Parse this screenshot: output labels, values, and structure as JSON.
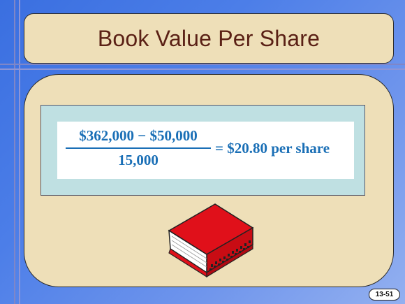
{
  "slide": {
    "title": "Book Value Per Share",
    "formula": {
      "numerator": "$362,000 − $50,000",
      "denominator": "15,000",
      "result": "= $20.80 per share"
    },
    "image_icon": "red-book-icon",
    "page_number": "13-51"
  },
  "colors": {
    "background": "#4c7ee8",
    "panel": "#eedfb8",
    "title_text": "#5a2015",
    "formula_text": "#1a6fb6",
    "formula_backdrop": "#bfe0e2",
    "book_cover": "#e0101a"
  }
}
